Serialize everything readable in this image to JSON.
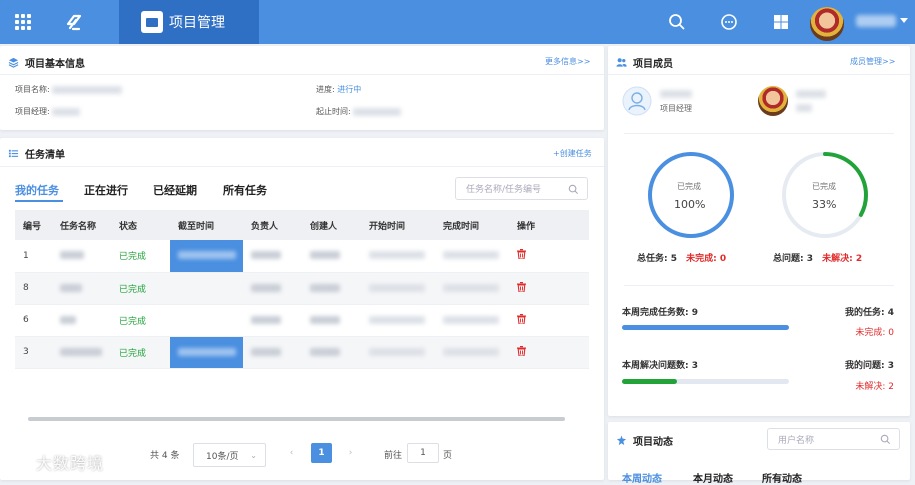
{
  "header": {
    "active_tab": "项目管理",
    "icons": [
      "apps-grid-icon",
      "logo-icon",
      "search-icon",
      "message-icon",
      "windows-icon"
    ]
  },
  "project_info": {
    "title": "项目基本信息",
    "more_link": "更多信息>>",
    "name_label": "项目名称:",
    "manager_label": "项目经理:",
    "progress_label": "进度:",
    "progress_value": "进行中",
    "deadline_label": "起止时间:"
  },
  "tasks": {
    "title": "任务清单",
    "create_link": "+创建任务",
    "tabs": [
      "我的任务",
      "正在进行",
      "已经延期",
      "所有任务"
    ],
    "active_tab": 0,
    "search_placeholder": "任务名称/任务编号",
    "columns": [
      "编号",
      "任务名称",
      "状态",
      "截至时间",
      "负责人",
      "创建人",
      "开始时间",
      "完成时间",
      "操作"
    ],
    "rows": [
      {
        "id": "1",
        "status": "已完成"
      },
      {
        "id": "8",
        "status": "已完成"
      },
      {
        "id": "6",
        "status": "已完成"
      },
      {
        "id": "3",
        "status": "已完成"
      }
    ]
  },
  "pagination": {
    "total": "共 4 条",
    "page_size": "10条/页",
    "current_page": "1",
    "goto_prefix": "前往",
    "goto_value": "1",
    "goto_suffix": "页"
  },
  "watermark": "大数跨境",
  "members": {
    "title": "项目成员",
    "manage_link": "成员管理>>",
    "role_label": "项目经理"
  },
  "stats": {
    "task_ring_label": "已完成",
    "task_ring_value": "100%",
    "task_ring_progress": 1.0,
    "issue_ring_label": "已完成",
    "issue_ring_value": "33%",
    "issue_ring_progress": 0.33,
    "total_tasks_label": "总任务:",
    "total_tasks": "5",
    "unfinished_label": "未完成:",
    "unfinished": "0",
    "total_issues_label": "总问题:",
    "total_issues": "3",
    "unresolved_label": "未解决:",
    "unresolved": "2"
  },
  "weekly": {
    "tasks_done_label": "本周完成任务数:",
    "tasks_done": "9",
    "tasks_done_progress": 1.0,
    "my_tasks_label": "我的任务:",
    "my_tasks": "4",
    "my_unfinished_label": "未完成:",
    "my_unfinished": "0",
    "issues_resolved_label": "本周解决问题数:",
    "issues_resolved": "3",
    "issues_resolved_progress": 0.33,
    "my_issues_label": "我的问题:",
    "my_issues": "3",
    "my_unresolved_label": "未解决:",
    "my_unresolved": "2"
  },
  "activity": {
    "title": "项目动态",
    "search_placeholder": "用户名称",
    "tabs": [
      "本周动态",
      "本月动态",
      "所有动态"
    ]
  },
  "colors": {
    "primary": "#4a8fe0",
    "success": "#22a33a",
    "danger": "#e02b2b"
  }
}
